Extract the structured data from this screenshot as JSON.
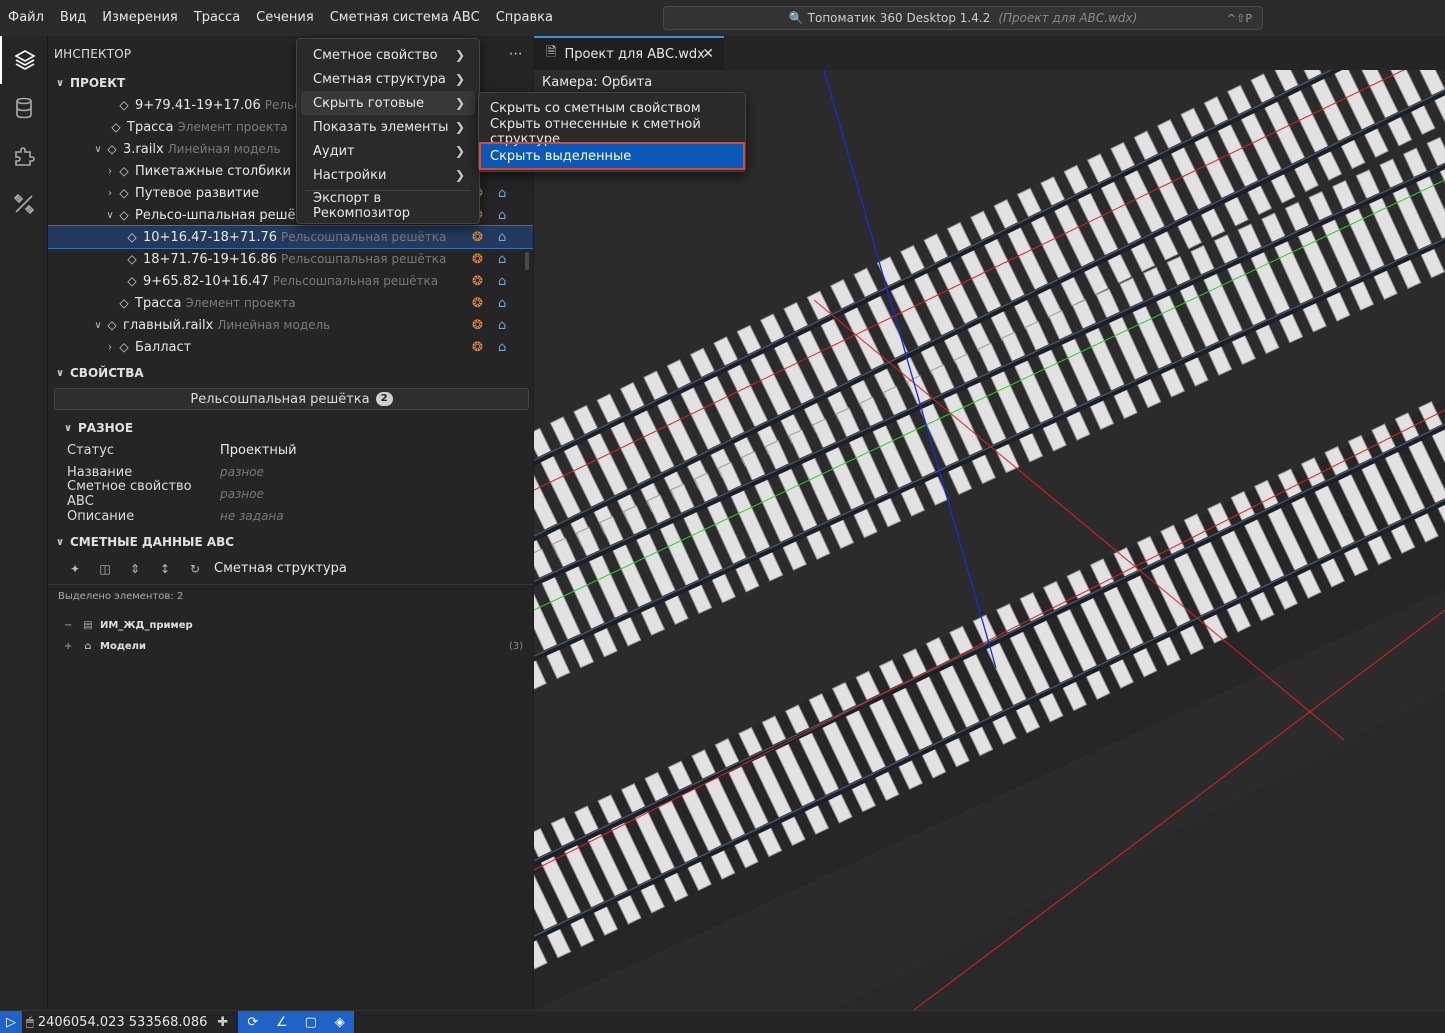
{
  "menubar": {
    "items": [
      "Файл",
      "Вид",
      "Измерения",
      "Трасса",
      "Сечения",
      "Сметная система АВС",
      "Справка"
    ]
  },
  "command_center": {
    "title": "Топоматик 360 Desktop 1.4.2",
    "project": "(Проект для АВС.wdx)",
    "shortcut": "^⇧P"
  },
  "activity_icons": [
    "layers-icon",
    "database-icon",
    "puzzle-icon",
    "tools-icon"
  ],
  "inspector": {
    "title": "ИНСПЕКТОР",
    "project_section": "ПРОЕКТ",
    "tree": [
      {
        "label": "9+79.41-19+17.06",
        "sub": "Рельсошпальная решётка",
        "indent": 56,
        "twisty": "",
        "icon": "layers"
      },
      {
        "label": "Трасса",
        "sub": "Элемент проекта",
        "indent": 48,
        "twisty": "",
        "icon": "layers"
      },
      {
        "label": "3.railx",
        "sub": "Линейная модель",
        "indent": 44,
        "twisty": "v",
        "icon": "layers"
      },
      {
        "label": "Пикетажные столбики",
        "sub": "",
        "indent": 56,
        "twisty": ">",
        "icon": "layers"
      },
      {
        "label": "Путевое развитие",
        "sub": "",
        "indent": 56,
        "twisty": ">",
        "icon": "layers"
      },
      {
        "label": "Рельсо-шпальная решётка",
        "sub": "",
        "indent": 56,
        "twisty": "v",
        "icon": "layers"
      },
      {
        "label": "10+16.47-18+71.76",
        "sub": "Рельсошпальная решётка",
        "indent": 64,
        "twisty": "",
        "icon": "layers",
        "selected": true
      },
      {
        "label": "18+71.76-19+16.86",
        "sub": "Рельсошпальная решётка",
        "indent": 64,
        "twisty": "",
        "icon": "layers"
      },
      {
        "label": "9+65.82-10+16.47",
        "sub": "Рельсошпальная решётка",
        "indent": 64,
        "twisty": "",
        "icon": "layers"
      },
      {
        "label": "Трасса",
        "sub": "Элемент проекта",
        "indent": 56,
        "twisty": "",
        "icon": "layers"
      },
      {
        "label": "главный.railx",
        "sub": "Линейная модель",
        "indent": 44,
        "twisty": "v",
        "icon": "layers"
      },
      {
        "label": "Балласт",
        "sub": "",
        "indent": 56,
        "twisty": ">",
        "icon": "layers"
      }
    ]
  },
  "properties": {
    "title": "СВОЙСТВА",
    "type_label": "Рельсошпальная решётка",
    "type_count": "2",
    "group_title": "РАЗНОЕ",
    "rows": [
      {
        "key": "Статус",
        "value": "Проектный",
        "italic": false
      },
      {
        "key": "Название",
        "value": "разное",
        "italic": true
      },
      {
        "key": "Сметное свойство АВС",
        "value": "разное",
        "italic": true
      },
      {
        "key": "Описание",
        "value": "не задана",
        "italic": true
      }
    ]
  },
  "estimate": {
    "title": "СМЕТНЫЕ ДАННЫЕ АВС",
    "structure_label": "Сметная структура",
    "selected_count": "Выделено элементов: 2",
    "items": [
      {
        "pm": "−",
        "label": "ИМ_ЖД_пример",
        "count": ""
      },
      {
        "pm": "+",
        "label": "Модели",
        "count": "(3)"
      }
    ]
  },
  "context_menu": {
    "items": [
      {
        "label": "Сметное свойство",
        "arrow": true
      },
      {
        "label": "Сметная структура",
        "arrow": true
      },
      {
        "label": "Скрыть готовые",
        "arrow": true,
        "hover": true
      },
      {
        "label": "Показать элементы",
        "arrow": true
      },
      {
        "label": "Аудит",
        "arrow": true
      },
      {
        "label": "Настройки",
        "arrow": true
      }
    ],
    "export_label": "Экспорт в Рекомпозитор",
    "submenu": [
      {
        "label": "Скрыть со сметным свойством",
        "active": false
      },
      {
        "label": "Скрыть отнесенные к сметной структуре",
        "active": false
      },
      {
        "label": "Скрыть выделенные",
        "active": true
      }
    ]
  },
  "editor": {
    "tab_label": "Проект для АВС.wdx",
    "camera_label": "Камера: Орбита"
  },
  "statusbar": {
    "coordinates": "2406054.023 533568.086"
  },
  "colors": {
    "accent": "#1f63c9",
    "selection": "#233a5e",
    "highlight_outline": "#d9473b",
    "bulb": "#e8943a",
    "lock": "#7aa2e8"
  }
}
